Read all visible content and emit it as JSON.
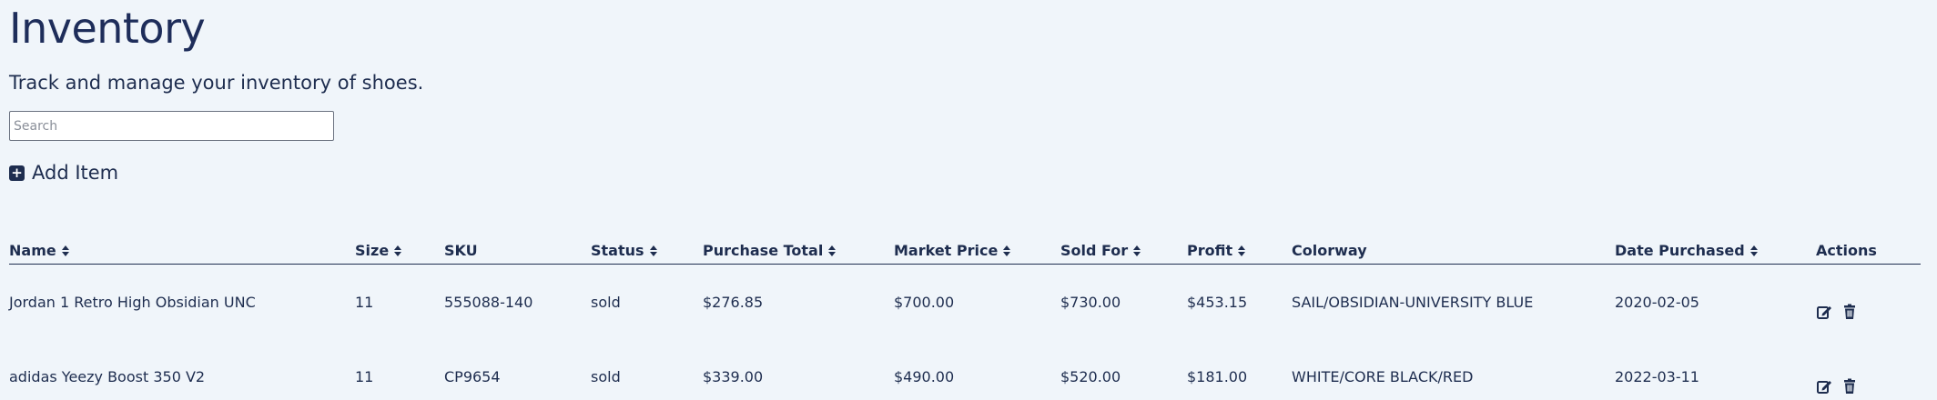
{
  "page": {
    "title": "Inventory",
    "subtitle": "Track and manage your inventory of shoes."
  },
  "search": {
    "placeholder": "Search",
    "value": ""
  },
  "toolbar": {
    "add_item_label": "Add Item",
    "add_icon": "plus-square-icon"
  },
  "table": {
    "columns": [
      {
        "label": "Name",
        "sortable": true
      },
      {
        "label": "Size",
        "sortable": true
      },
      {
        "label": "SKU",
        "sortable": false
      },
      {
        "label": "Status",
        "sortable": true
      },
      {
        "label": "Purchase Total",
        "sortable": true
      },
      {
        "label": "Market Price",
        "sortable": true
      },
      {
        "label": "Sold For",
        "sortable": true
      },
      {
        "label": "Profit",
        "sortable": true
      },
      {
        "label": "Colorway",
        "sortable": false
      },
      {
        "label": "Date Purchased",
        "sortable": true
      },
      {
        "label": "Actions",
        "sortable": false
      }
    ],
    "rows": [
      {
        "name": "Jordan 1 Retro High Obsidian UNC",
        "size": "11",
        "sku": "555088-140",
        "status": "sold",
        "purchase_total": "$276.85",
        "market_price": "$700.00",
        "sold_for": "$730.00",
        "profit": "$453.15",
        "colorway": "SAIL/OBSIDIAN-UNIVERSITY BLUE",
        "date_purchased": "2020-02-05"
      },
      {
        "name": "adidas Yeezy Boost 350 V2",
        "size": "11",
        "sku": "CP9654",
        "status": "sold",
        "purchase_total": "$339.00",
        "market_price": "$490.00",
        "sold_for": "$520.00",
        "profit": "$181.00",
        "colorway": "WHITE/CORE BLACK/RED",
        "date_purchased": "2022-03-11"
      }
    ],
    "action_icons": [
      "edit-icon",
      "trash-icon"
    ]
  },
  "colors": {
    "background": "#f0f5fa",
    "text": "#1e2d4f",
    "title": "#1e2d5a"
  }
}
